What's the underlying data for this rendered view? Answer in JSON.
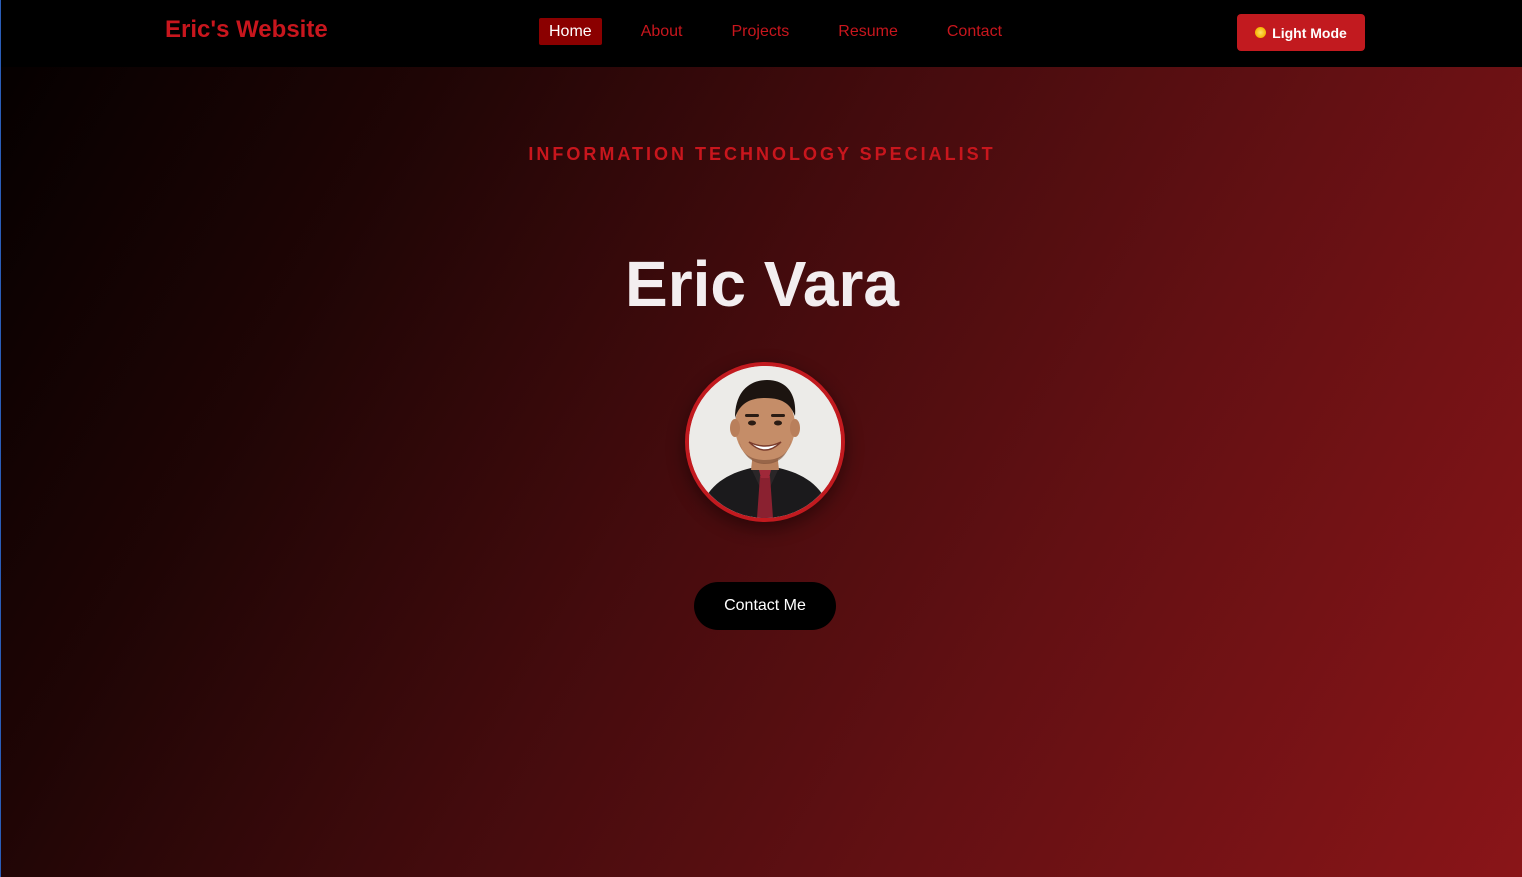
{
  "navbar": {
    "brand": "Eric's Website",
    "links": [
      {
        "label": "Home",
        "active": true
      },
      {
        "label": "About",
        "active": false
      },
      {
        "label": "Projects",
        "active": false
      },
      {
        "label": "Resume",
        "active": false
      },
      {
        "label": "Contact",
        "active": false
      }
    ],
    "mode_toggle": {
      "label": "Light Mode",
      "icon": "sun-icon"
    }
  },
  "hero": {
    "subtitle": "INFORMATION TECHNOLOGY SPECIALIST",
    "name": "Eric Vara",
    "avatar_icon": "profile-photo",
    "cta_label": "Contact Me"
  },
  "colors": {
    "accent": "#c8161d",
    "active_nav_bg": "#8b0000",
    "button_red": "#c21a1f",
    "navbar_bg": "#000000",
    "hero_gradient_start": "#050000",
    "hero_gradient_end": "#8a1518",
    "name_text": "#f3eef0"
  }
}
